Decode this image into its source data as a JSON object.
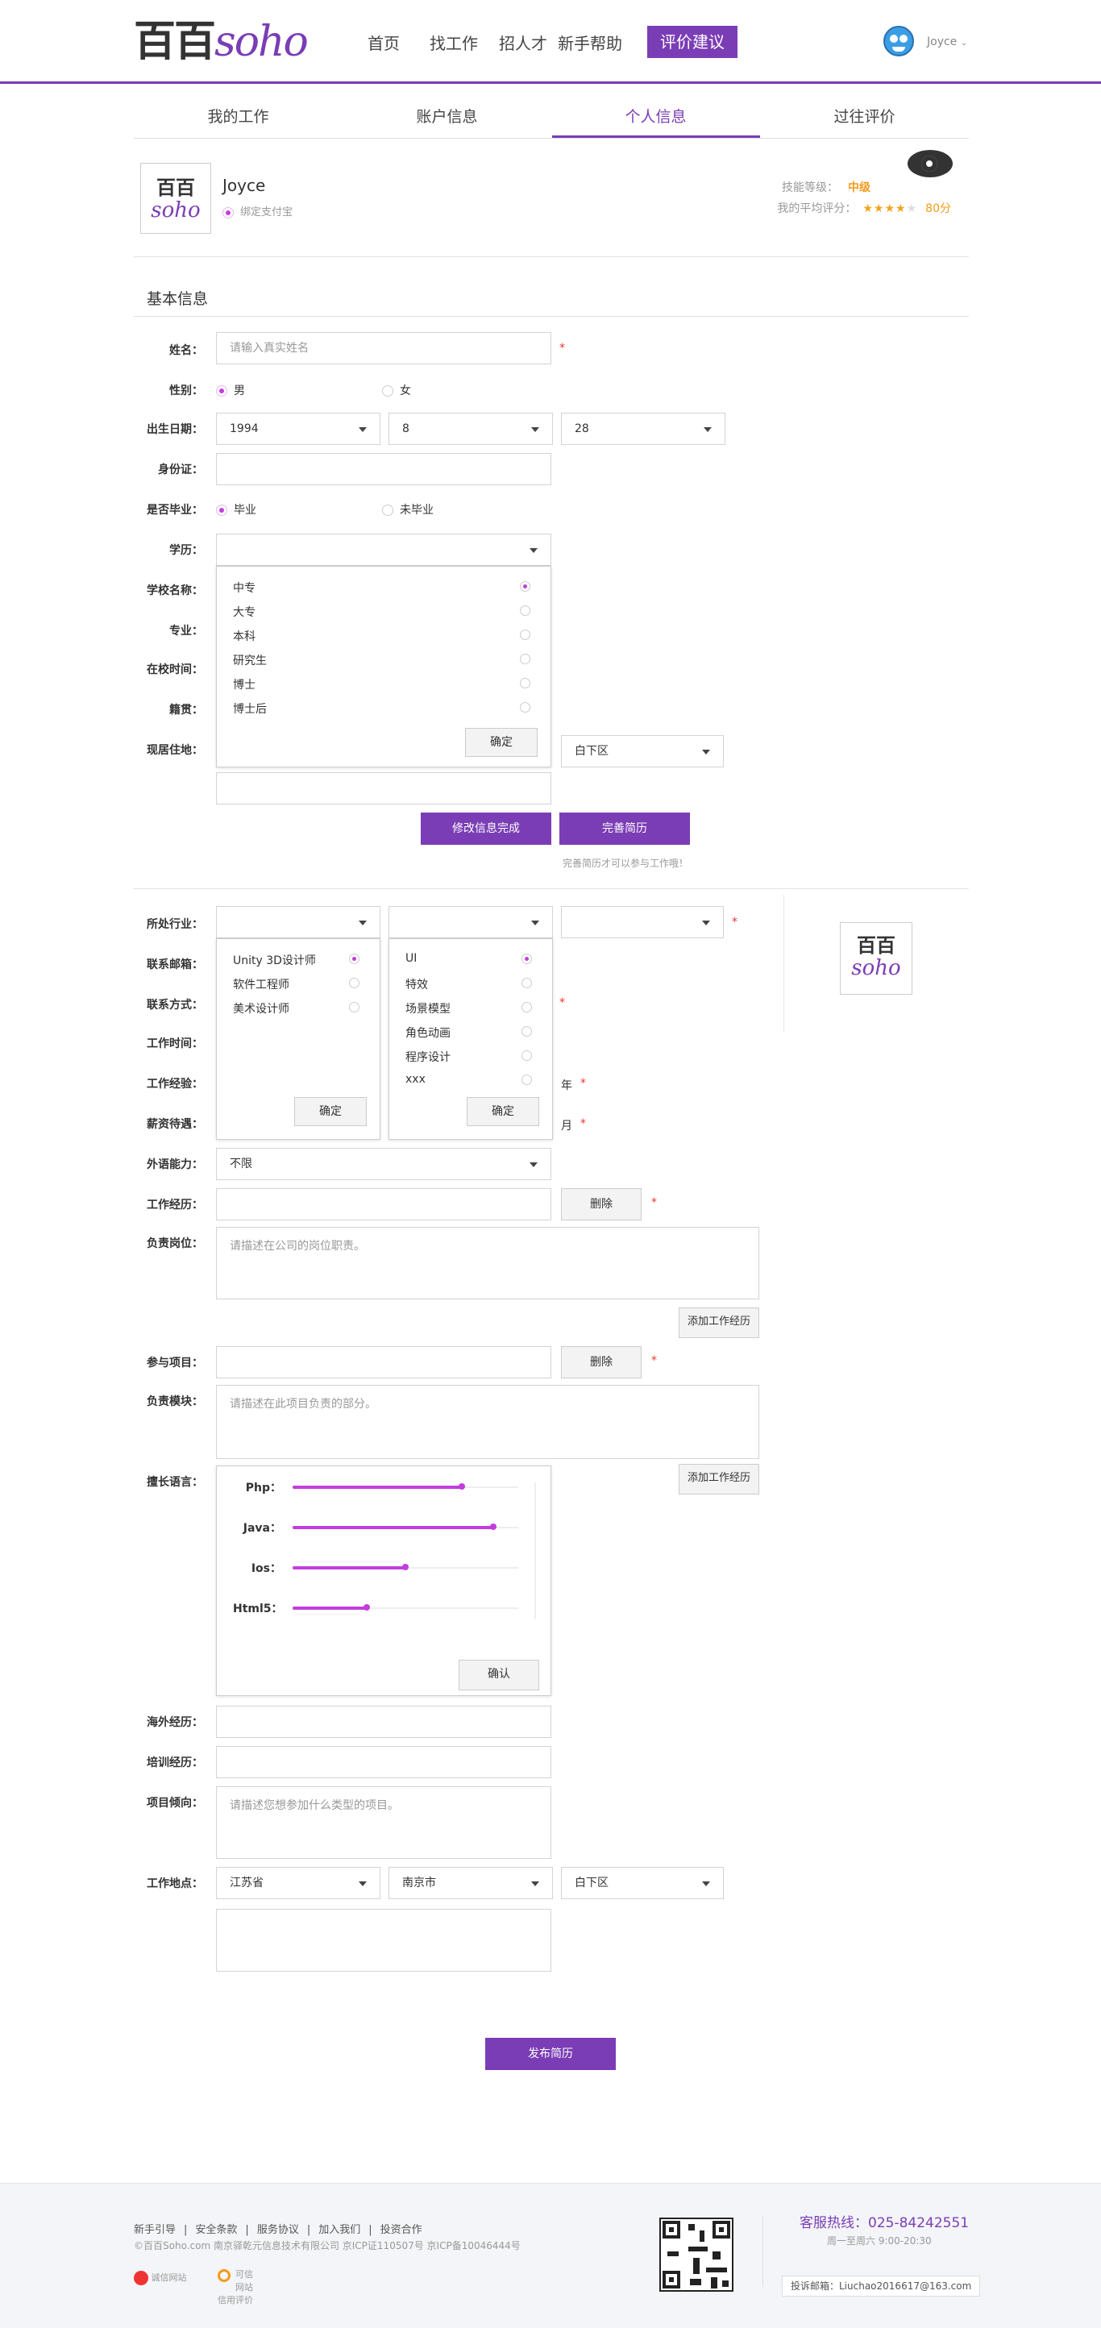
{
  "header": {
    "nav": [
      "首页",
      "找工作",
      "招人才",
      "新手帮助"
    ],
    "feedback_label": "评价建议",
    "username": "Joyce"
  },
  "tabs": [
    "我的工作",
    "账户信息",
    "个人信息",
    "过往评价"
  ],
  "profile": {
    "name": "Joyce",
    "alipay": "绑定支付宝",
    "skill_level_label": "技能等级：",
    "skill_level": "中级",
    "avg_score_label": "我的平均评分：",
    "stars": 4,
    "stars_max": 5,
    "score": "80分"
  },
  "basic": {
    "title": "基本信息",
    "name_label": "姓名：",
    "name_placeholder": "请输入真实姓名",
    "gender_label": "性别：",
    "gender_male": "男",
    "gender_female": "女",
    "birth_label": "出生日期：",
    "birth_year": "1994",
    "birth_month": "8",
    "birth_day": "28",
    "id_label": "身份证：",
    "graduated_label": "是否毕业：",
    "graduated_yes": "毕业",
    "graduated_no": "未毕业",
    "education_label": "学历：",
    "school_label": "学校名称：",
    "major_label": "专业：",
    "study_time_label": "在校时间：",
    "origin_label": "籍贯：",
    "address_label": "现居住地：",
    "district": "白下区",
    "education_options": [
      "中专",
      "大专",
      "本科",
      "研究生",
      "博士",
      "博士后"
    ],
    "confirm": "确定",
    "modify_done": "修改信息完成",
    "complete_resume": "完善简历",
    "hint": "完善简历才可以参与工作哦！"
  },
  "work": {
    "industry_label": "所处行业：",
    "email_label": "联系邮箱：",
    "contact_label": "联系方式：",
    "work_time_label": "工作时间：",
    "experience_label": "工作经验：",
    "experience_unit": "年",
    "salary_label": "薪资待遇：",
    "salary_unit": "月",
    "language_label": "外语能力：",
    "language_value": "不限",
    "work_history_label": "工作经历：",
    "delete": "删除",
    "position_label": "负责岗位：",
    "position_placeholder": "请描述在公司的岗位职责。",
    "add_work": "添加工作经历",
    "project_label": "参与项目：",
    "module_label": "负责模块：",
    "module_placeholder": "请描述在此项目负责的部分。",
    "skills_label": "擅长语言：",
    "skills": [
      {
        "name": "Php：",
        "level": 0.75
      },
      {
        "name": "Java：",
        "level": 0.89
      },
      {
        "name": "Ios：",
        "level": 0.5
      },
      {
        "name": "Html5：",
        "level": 0.33
      }
    ],
    "skills_confirm": "确认",
    "overseas_label": "海外经历：",
    "training_label": "培训经历：",
    "tendency_label": "项目倾向：",
    "tendency_placeholder": "请描述您想参加什么类型的项目。",
    "location_label": "工作地点：",
    "province": "江苏省",
    "city": "南京市",
    "location_district": "白下区",
    "job_options": [
      "Unity 3D设计师",
      "软件工程师",
      "美术设计师"
    ],
    "sub_options": [
      "UI",
      "特效",
      "场景模型",
      "角色动画",
      "程序设计",
      "xxx"
    ],
    "publish": "发布简历"
  },
  "footer": {
    "links": [
      "新手引导",
      "|",
      "安全条款",
      "|",
      "服务协议",
      "|",
      "加入我们",
      "|",
      "投资合作"
    ],
    "copyright": "©百百Soho.com   南京驿乾元信息技术有限公司   京ICP证110507号   京ICP备10046444号",
    "badge1": "诚信网站",
    "badge2a": "可信网站",
    "badge2b": "信用评价",
    "hotline": "客服热线：025-84242551",
    "hours": "周一至周六 9:00-20:30",
    "email": "投诉邮箱：Liuchao2016617@163.com"
  },
  "colors": {
    "accent": "#7a3db5",
    "star": "#f3a31a",
    "radio": "#c33ddc"
  }
}
